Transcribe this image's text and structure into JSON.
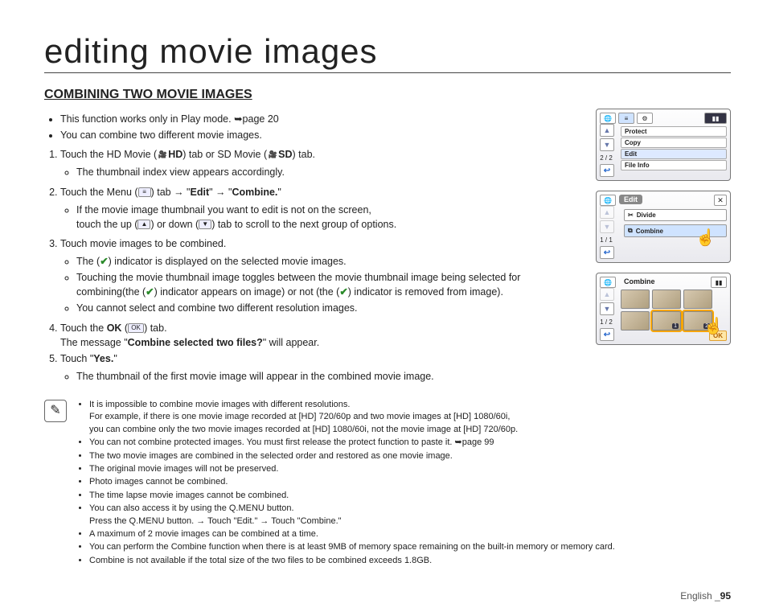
{
  "page_title": "editing movie images",
  "section_title": "COMBINING TWO MOVIE IMAGES",
  "intro": [
    "This function works only in Play mode. ➥page 20",
    "You can combine two different movie images."
  ],
  "steps": {
    "s1": {
      "lead": "Touch the HD Movie (",
      "hd": "HD",
      "mid": ") tab or SD Movie (",
      "sd": "SD",
      "tail": ") tab.",
      "sub": "The thumbnail index view appears accordingly."
    },
    "s2": {
      "lead": "Touch the Menu (",
      "mid": ") tab → \"",
      "edit": "Edit",
      "mid2": "\" → \"",
      "combine": "Combine.",
      "tail": "\"",
      "sub1": "If the movie image thumbnail you want to edit is not on the screen,",
      "sub2a": "touch the up (",
      "sub2b": ") or down (",
      "sub2c": ") tab to scroll to the next group of options."
    },
    "s3": {
      "lead": "Touch movie images to be combined.",
      "b1a": "The (",
      "b1b": ") indicator is displayed on the selected movie images.",
      "b2a": "Touching the movie thumbnail image toggles between the movie thumbnail image being selected for combining(the (",
      "b2b": ") indicator appears on image) or not (the (",
      "b2c": ") indicator is removed from image).",
      "b3": "You cannot select and combine two different resolution images."
    },
    "s4": {
      "lead1": "Touch the ",
      "ok": "OK",
      "lead2": " (",
      "lead3": ") tab.",
      "sub1": "The message \"",
      "msg": "Combine selected two files?",
      "sub2": "\" will appear."
    },
    "s5": {
      "lead": "Touch \"",
      "yes": "Yes.",
      "tail": "\"",
      "sub": "The thumbnail of the first movie image will appear in the combined movie image."
    }
  },
  "icons": {
    "menu": "≡",
    "up": "▲",
    "down": "▼",
    "check": "✔",
    "ok": "OK",
    "back": "↩",
    "close": "✕",
    "arrow": "➥"
  },
  "screens": {
    "s1": {
      "page": "2 / 2",
      "items": [
        "Protect",
        "Copy",
        "Edit",
        "File Info"
      ]
    },
    "s2": {
      "title": "Edit",
      "page": "1 / 1",
      "divide": "Divide",
      "combine": "Combine"
    },
    "s3": {
      "title": "Combine",
      "page": "1 / 2",
      "ok": "OK",
      "badge1": "1",
      "badge2": "2"
    }
  },
  "notes": [
    "It is impossible to combine movie images with different resolutions.",
    "For example, if there is one movie image recorded at [HD] 720/60p and two movie images at [HD] 1080/60i,",
    "you can combine only the two movie images recorded at [HD] 1080/60i, not the movie image at [HD] 720/60p.",
    "You can not combine protected images. You must first release the protect function to paste it. ➥page 99",
    "The two movie images are combined in the selected order and restored as one movie image.",
    "The original movie images will not be preserved.",
    "Photo images cannot be combined.",
    "The time lapse movie images cannot be combined.",
    "You can also access it by using the Q.MENU button.",
    "Press the Q.MENU button. → Touch \"Edit.\" → Touch \"Combine.\"",
    "A maximum of 2 movie images can be combined at a time.",
    "You can perform the Combine function when there is at least 9MB of memory space remaining on the built-in memory or memory card.",
    "Combine is not available if the total size of the two files to be combined exceeds 1.8GB."
  ],
  "notes_bold": {
    "qmenu": "Q.MENU"
  },
  "footer": {
    "lang": "English _",
    "page": "95"
  }
}
